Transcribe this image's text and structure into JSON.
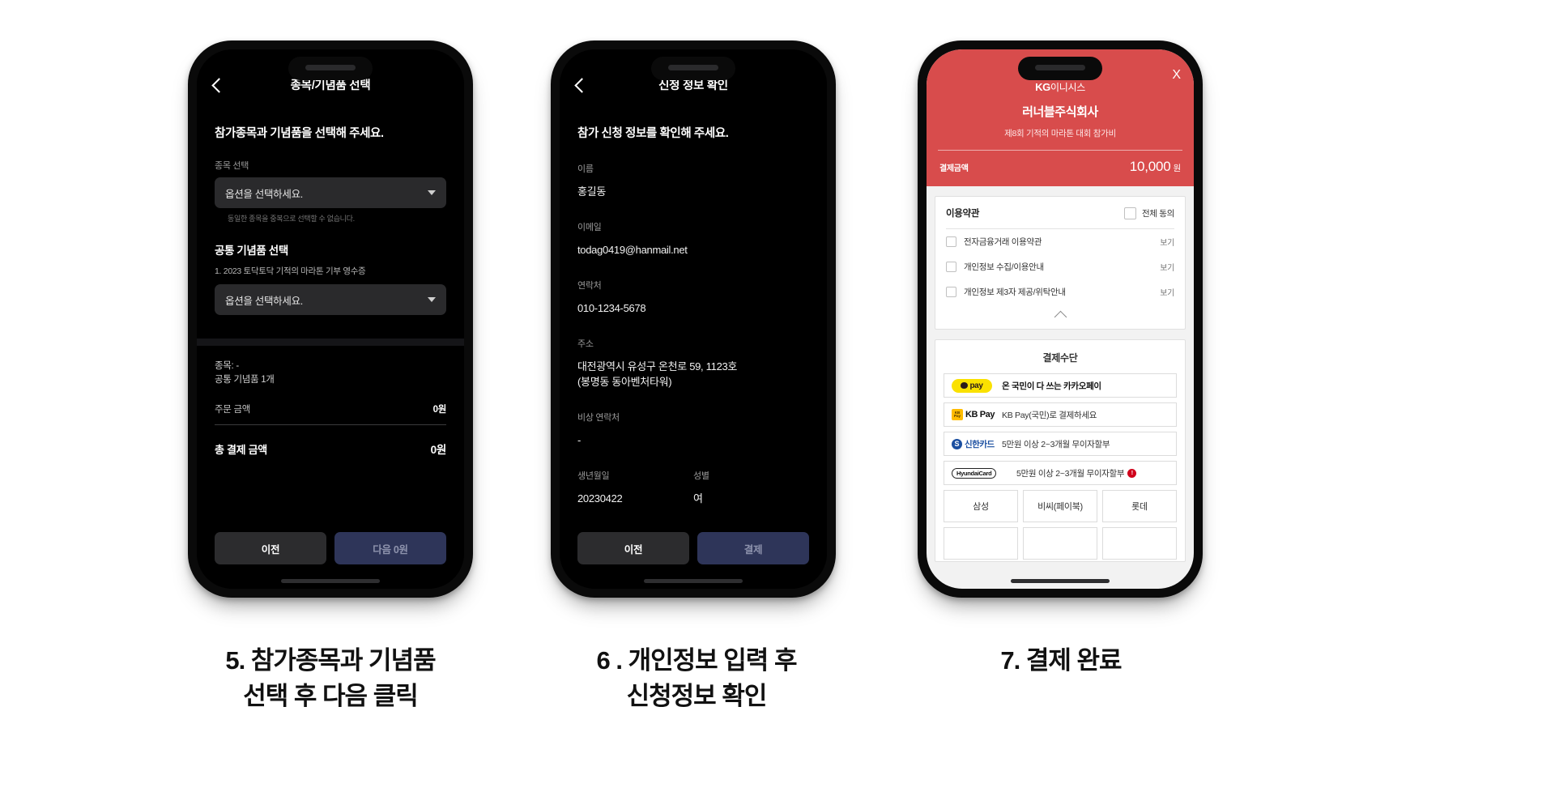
{
  "phone1": {
    "nav_title": "종목/기념품 선택",
    "back_icon": "chevron-left-icon",
    "page_heading": "참가종목과 기념품을 선택해 주세요.",
    "event_label": "종목 선택",
    "event_select_value": "옵션을 선택하세요.",
    "event_hint": "동일한 종목을 중복으로 선택할 수 없습니다.",
    "gift_section_title": "공통 기념품 선택",
    "gift_item_label": "1. 2023 토닥토닥 기적의 마라톤 기부 영수증",
    "gift_select_value": "옵션을 선택하세요.",
    "summary_line1": "종목: -",
    "summary_line2": "공통 기념품 1개",
    "order_amount_label": "주문 금액",
    "order_amount_value": "0원",
    "total_label": "총 결제 금액",
    "total_value": "0원",
    "btn_prev": "이전",
    "btn_next": "다음 0원"
  },
  "phone2": {
    "nav_title": "신청 정보 확인",
    "back_icon": "chevron-left-icon",
    "page_heading": "참가 신청 정보를 확인해 주세요.",
    "fields": [
      {
        "label": "이름",
        "value": "홍길동"
      },
      {
        "label": "이메일",
        "value": "todag0419@hanmail.net"
      },
      {
        "label": "연락처",
        "value": "010-1234-5678"
      },
      {
        "label": "주소",
        "value": "대전광역시 유성구 온천로 59, 1123호\n(봉명동 동아벤처타워)"
      },
      {
        "label": "비상 연락처",
        "value": "-"
      }
    ],
    "birth_label": "생년월일",
    "birth_value": "20230422",
    "gender_label": "성별",
    "gender_value": "여",
    "btn_prev": "이전",
    "btn_pay": "결제"
  },
  "phone3": {
    "close_label": "X",
    "brand_bold": "KG",
    "brand_rest": "이니시스",
    "corp_name": "러너블주식회사",
    "product_desc": "제8회 기적의 마라톤 대회 참가비",
    "amount_label": "결제금액",
    "amount_value": "10,000",
    "amount_unit": "원",
    "accent_color": "#d84c4c",
    "terms": {
      "title": "이용약관",
      "agree_all_label": "전체 동의",
      "view_label": "보기",
      "items": [
        "전자금융거래 이용약관",
        "개인정보 수집/이용안내",
        "개인정보 제3자 제공/위탁안내"
      ]
    },
    "payment": {
      "title": "결제수단",
      "rows": [
        {
          "logo": "kakaopay-logo",
          "text": "온 국민이 다 쓰는 카카오페이",
          "bold": true
        },
        {
          "logo": "kbpay-logo",
          "text": "KB Pay(국민)로 결제하세요",
          "bold": false
        },
        {
          "logo": "shinhancard-logo",
          "text": "5만원 이상 2~3개월 무이자할부",
          "bold": false
        },
        {
          "logo": "hyundaicard-logo",
          "text": "5만원 이상 2~3개월 무이자할부",
          "bold": false,
          "warn": true
        }
      ],
      "kakao_pay_text": "pay",
      "kb_pay_text": "KB Pay",
      "kb_badge_text": "KB Pay",
      "shinhan_text": "신한카드",
      "shinhan_mark": "S",
      "hyundai_text": "HyundaiCard",
      "grid": [
        "삼성",
        "비씨(페이북)",
        "롯데"
      ]
    }
  },
  "captions": {
    "c1_line1": "5. 참가종목과 기념품",
    "c1_line2": "선택 후 다음 클릭",
    "c2_line1": "6 . 개인정보 입력 후",
    "c2_line2": "신청정보 확인",
    "c3_line1": "7. 결제 완료"
  }
}
